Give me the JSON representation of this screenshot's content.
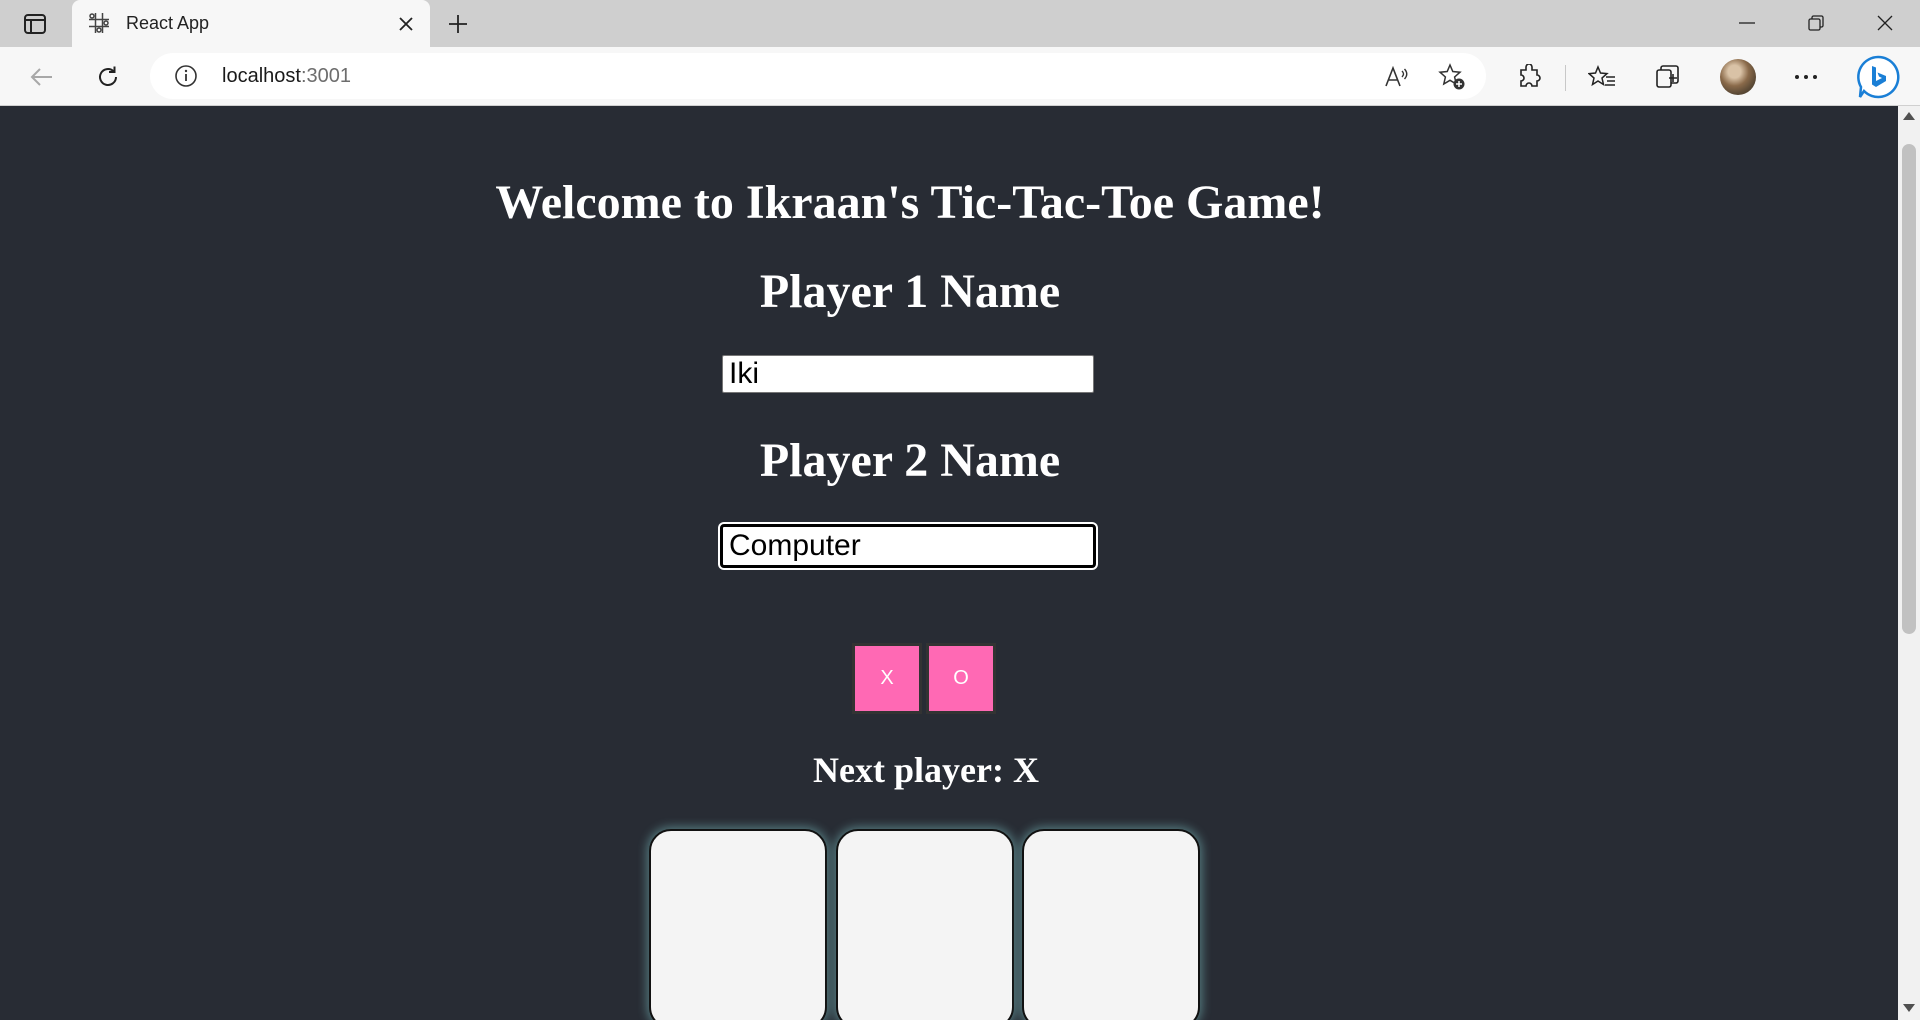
{
  "browser": {
    "tab": {
      "title": "React App",
      "favicon": "tic-tac-toe-grid-icon"
    },
    "address": {
      "host": "localhost",
      "port": ":3001"
    },
    "icons": [
      "sidebar-toggle-icon",
      "close-icon",
      "plus-icon",
      "minimize-icon",
      "restore-icon",
      "window-close-icon",
      "back-arrow-icon",
      "reload-icon",
      "info-icon",
      "read-aloud-icon",
      "favorite-add-icon",
      "extensions-icon",
      "favorites-icon",
      "collections-icon",
      "profile-avatar",
      "more-icon",
      "bing-icon"
    ]
  },
  "page": {
    "welcome": "Welcome to Ikraan's Tic-Tac-Toe Game!",
    "player1_heading": "Player 1 Name",
    "player1_value": "Iki",
    "player2_heading": "Player 2 Name",
    "player2_value": "Computer",
    "choice_x": "X",
    "choice_o": "O",
    "next_player": "Next player: X",
    "board_cells": [
      "",
      "",
      ""
    ]
  },
  "colors": {
    "page_background": "#282c34",
    "choice_button": "#ff69b4",
    "cell_background": "#f4f4f4"
  }
}
